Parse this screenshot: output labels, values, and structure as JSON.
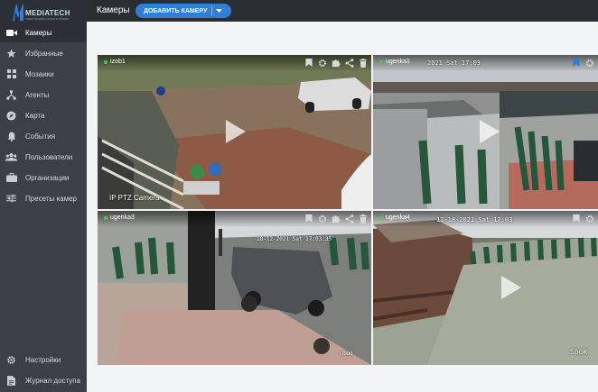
{
  "app": {
    "brand": "MEDIATECH",
    "brand_sub": "VIDEO SURVEILLANCE SYSTEMS"
  },
  "header": {
    "title": "Камеры",
    "add_button": "ДОБАВИТЬ КАМЕРУ"
  },
  "sidebar": {
    "items": [
      {
        "label": "Камеры",
        "icon": "video-camera-icon",
        "active": true
      },
      {
        "label": "Избранные",
        "icon": "star-icon"
      },
      {
        "label": "Мозаики",
        "icon": "grid-icon"
      },
      {
        "label": "Агенты",
        "icon": "agents-network-icon"
      },
      {
        "label": "Карта",
        "icon": "compass-icon"
      },
      {
        "label": "События",
        "icon": "bell-icon"
      },
      {
        "label": "Пользователи",
        "icon": "users-icon"
      },
      {
        "label": "Организации",
        "icon": "briefcase-icon"
      },
      {
        "label": "Пресеты камер",
        "icon": "sliders-icon"
      }
    ],
    "bottom_items": [
      {
        "label": "Настройки",
        "icon": "gear-icon"
      },
      {
        "label": "Журнал доступа",
        "icon": "document-icon"
      }
    ]
  },
  "cameras": [
    {
      "name": "izob1",
      "status": "online",
      "overlay_caption": "IP PTZ Camera",
      "timestamp": ""
    },
    {
      "name": "ugenka1",
      "status": "online",
      "overlay_caption": "",
      "timestamp": "2021 Sat 17:03"
    },
    {
      "name": "ugenka3",
      "status": "online",
      "overlay_caption": "Ubod",
      "timestamp": "18-12-2021 Sat 17:03:35"
    },
    {
      "name": "ugenka4",
      "status": "online",
      "overlay_caption": "Sbok",
      "timestamp": "12-18-2021 Sat 17:03"
    }
  ],
  "colors": {
    "accent": "#2f7fd6",
    "sidebar": "#3b3f46",
    "topbar": "#2a2d32",
    "online": "#49c84c"
  }
}
